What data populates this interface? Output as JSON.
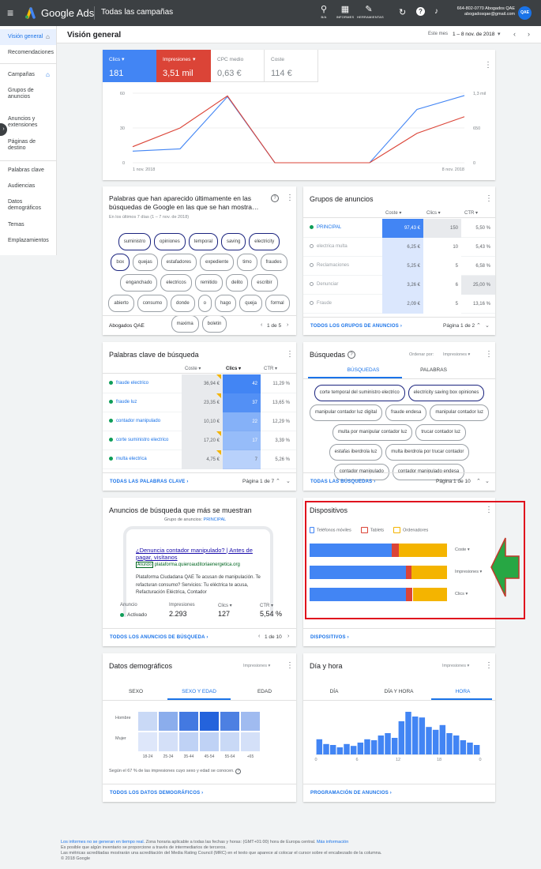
{
  "topbar": {
    "brand": "Google Ads",
    "campaign": "Todas las campañas",
    "icons": [
      {
        "name": "search-icon",
        "label": "B/A"
      },
      {
        "name": "reports-icon",
        "label": "INFORMES"
      },
      {
        "name": "tools-icon",
        "label": "HERRAMIENTAS"
      }
    ],
    "account_line1": "664-802-0770 Abogados QAE",
    "account_line2": "abogadosqae@gmail.com",
    "avatar": "QAE"
  },
  "sidebar": {
    "items": [
      "Visión general",
      "Recomendaciones",
      "Campañas",
      "Grupos de\nanuncios",
      "Anuncios y\nextensiones",
      "Páginas de\ndestino",
      "Palabras clave",
      "Audiencias",
      "Datos\ndemográficos",
      "Temas",
      "Emplazamientos"
    ]
  },
  "header": {
    "title": "Visión general",
    "range_label": "Este mes",
    "range": "1 – 8 nov. de 2018"
  },
  "metrics": {
    "tiles": [
      {
        "label": "Clics",
        "value": "181",
        "color": "#4285f4"
      },
      {
        "label": "Impresiones",
        "value": "3,51 mil",
        "color": "#db4437"
      },
      {
        "label": "CPC medio",
        "value": "0,63 €"
      },
      {
        "label": "Coste",
        "value": "114 €"
      }
    ],
    "chart_data": {
      "type": "line",
      "x": [
        "1 nov. 2018",
        "2 nov.",
        "3 nov.",
        "4 nov.",
        "5 nov.",
        "6 nov.",
        "7 nov.",
        "8 nov. 2018"
      ],
      "series": [
        {
          "name": "Clics",
          "color": "#4285f4",
          "values": [
            10,
            12,
            57,
            0,
            0,
            0,
            46,
            58
          ]
        },
        {
          "name": "Impresiones",
          "color": "#db4437",
          "values": [
            300,
            650,
            1250,
            0,
            0,
            0,
            550,
            860
          ]
        }
      ],
      "yleft": [
        "60",
        "30",
        "0"
      ],
      "yright": [
        "1,3 mil",
        "650",
        "0"
      ],
      "xlabels": [
        "1 nov. 2018",
        "8 nov. 2018"
      ]
    }
  },
  "search_terms": {
    "title": "Palabras que han aparecido últimamente en las búsquedas de Google en las que se han mostra…",
    "subtitle": "En los últimos 7 días (1 – 7 nov. de 2018)",
    "pills": [
      "suministro",
      "opiniones",
      "temporal",
      "saving",
      "electricity",
      "box",
      "quejas",
      "estafadores",
      "expediente",
      "timo",
      "fraudes",
      "enganchado",
      "electricos",
      "remitido",
      "delito",
      "escribir",
      "abierto",
      "consumo",
      "donde",
      "o",
      "hago",
      "queja",
      "formal",
      "maxima",
      "boletin"
    ],
    "footer": "Abogados QAE",
    "pagination": "1 de 5"
  },
  "ad_groups": {
    "title": "Grupos de anuncios",
    "cols": [
      "Coste",
      "Clics",
      "CTR"
    ],
    "rows": [
      {
        "name": "PRINCIPAL",
        "cost": "97,43 €",
        "clicks": "150",
        "ctr": "5,50 %",
        "active": true
      },
      {
        "name": "electrica multa",
        "cost": "6,25 €",
        "clicks": "10",
        "ctr": "5,43 %"
      },
      {
        "name": "Reclamaciones",
        "cost": "5,25 €",
        "clicks": "5",
        "ctr": "6,58 %"
      },
      {
        "name": "Denunciar",
        "cost": "3,26 €",
        "clicks": "6",
        "ctr": "25,00 %"
      },
      {
        "name": "Fraude",
        "cost": "2,09 €",
        "clicks": "5",
        "ctr": "13,16 %"
      }
    ],
    "footer": "TODOS LOS GRUPOS DE ANUNCIOS",
    "pagination": "Página 1 de 2"
  },
  "keywords": {
    "title": "Palabras clave de búsqueda",
    "cols": [
      "Coste",
      "Clics",
      "CTR"
    ],
    "rows": [
      {
        "name": "fraude electrico",
        "cost": "36,94 €",
        "clicks": "42",
        "ctr": "11,29 %"
      },
      {
        "name": "fraude luz",
        "cost": "23,35 €",
        "clicks": "37",
        "ctr": "13,65 %"
      },
      {
        "name": "contador manipulado",
        "cost": "10,10 €",
        "clicks": "22",
        "ctr": "12,29 %"
      },
      {
        "name": "corte suministro electrico",
        "cost": "17,20 €",
        "clicks": "17",
        "ctr": "3,39 %"
      },
      {
        "name": "multa electrica",
        "cost": "4,75 €",
        "clicks": "7",
        "ctr": "5,26 %"
      }
    ],
    "footer": "TODAS LAS PALABRAS CLAVE",
    "pagination": "Página 1 de 7"
  },
  "searches": {
    "title": "Búsquedas",
    "sort_label": "Ordenar por:",
    "sort_value": "Impresiones",
    "tabs": [
      "BÚSQUEDAS",
      "PALABRAS"
    ],
    "pills": [
      "corte temporal del suministro electrico",
      "electricity saving box opiniones",
      "manipular contador luz digital",
      "fraude endesa",
      "manipular contador luz",
      "multa por manipular contador luz",
      "trucar contador luz",
      "estafas iberdrola luz",
      "multa iberdrola por trucar contador",
      "contador manipulado",
      "contador manipulado endesa"
    ],
    "footer": "TODAS LAS BÚSQUEDAS",
    "pagination": "Página 1 de 10"
  },
  "ads": {
    "title": "Anuncios de búsqueda que más se muestran",
    "group_label": "Grupo de anuncios:",
    "group": "PRINCIPAL",
    "headline": "¿Denuncia contador manipulado? | Antes de pagar, visítanos",
    "badge": "Anuncio",
    "url": "plataforma.quieroauditoriaenergetica.org",
    "desc": "Plataforma Ciudadana QAE Te acusan de manipulación. Te refacturan consumo? Servicios: Tu eléctrica te acusa, Refacturación Eléctrica, Contador",
    "cols": [
      "Anuncio",
      "Impresiones",
      "Clics",
      "CTR"
    ],
    "status": "Activado",
    "impr": "2.293",
    "clicks": "127",
    "ctr": "5,54 %",
    "footer": "TODOS LOS ANUNCIOS DE BÚSQUEDA",
    "pagination": "1 de 10"
  },
  "devices": {
    "title": "Dispositivos",
    "legend": [
      {
        "label": "Teléfonos móviles",
        "color": "#4285f4"
      },
      {
        "label": "Tablets",
        "color": "#db4437"
      },
      {
        "label": "Ordenadores",
        "color": "#f4b400"
      }
    ],
    "bars": [
      {
        "label": "Coste",
        "values": [
          0.6,
          0.05,
          0.35
        ]
      },
      {
        "label": "Impresiones",
        "values": [
          0.7,
          0.04,
          0.26
        ]
      },
      {
        "label": "Clics",
        "values": [
          0.7,
          0.05,
          0.25
        ]
      }
    ],
    "footer": "DISPOSITIVOS"
  },
  "demo": {
    "title": "Datos demográficos",
    "metric": "Impresiones",
    "tabs": [
      "SEXO",
      "SEXO Y EDAD",
      "EDAD"
    ],
    "rows": [
      "Hombre",
      "Mujer"
    ],
    "ages": [
      "18-24",
      "25-34",
      "35-44",
      "45-54",
      "55-64",
      "+65"
    ],
    "heat": [
      [
        0.15,
        0.45,
        0.8,
        0.95,
        0.75,
        0.35
      ],
      [
        0.05,
        0.1,
        0.2,
        0.2,
        0.15,
        0.1
      ]
    ],
    "note": "Según el 67 % de las impresiones cuyo sexo y edad se conocen.",
    "footer": "TODOS LOS DATOS DEMOGRÁFICOS"
  },
  "dayhour": {
    "title": "Día y hora",
    "metric": "Impresiones",
    "tabs": [
      "DÍA",
      "DÍA Y HORA",
      "HORA"
    ],
    "chart_data": {
      "type": "bar",
      "x": [
        0,
        1,
        2,
        3,
        4,
        5,
        6,
        7,
        8,
        9,
        10,
        11,
        12,
        13,
        14,
        15,
        16,
        17,
        18,
        19,
        20,
        21,
        22,
        23
      ],
      "values": [
        32,
        22,
        20,
        15,
        22,
        18,
        25,
        32,
        30,
        40,
        45,
        35,
        70,
        90,
        80,
        78,
        58,
        52,
        62,
        45,
        40,
        30,
        25,
        20
      ],
      "xticks": [
        "0",
        "6",
        "12",
        "18",
        "0"
      ],
      "color": "#4285f4"
    },
    "footer": "PROGRAMACIÓN DE ANUNCIOS"
  },
  "footer": {
    "line1_link": "Los informes no se generan en tiempo real.",
    "line1_text": "Zona horaria aplicable a todas las fechas y horas: (GMT+01:00) hora de Europa central.",
    "line1_link2": "Más información",
    "line2": "Es posible que algún inventario se proporcione a través de intermediarios de terceros.",
    "line3": "Las métricas acreditadas mostrarán una acreditación del Media Rating Council (MRC) en el texto que aparece al colocar el cursor sobre el encabezado de la columna.",
    "line4": "© 2018 Google"
  }
}
